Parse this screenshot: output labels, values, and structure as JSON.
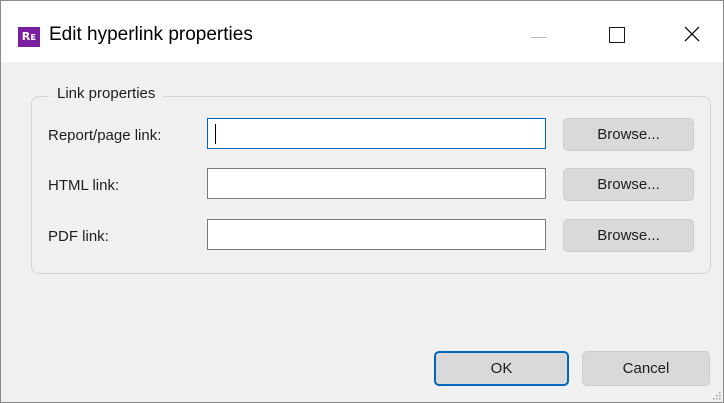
{
  "window": {
    "title": "Edit hyperlink properties",
    "app_icon_text": "Rᴇ",
    "accent_color": "#0067c0",
    "app_icon_color": "#7a1fa2"
  },
  "titlebar_buttons": {
    "minimize_icon": "minimize-icon",
    "maximize_icon": "maximize-icon",
    "close_icon": "close-icon"
  },
  "link_properties": {
    "group_label": "Link properties",
    "report_label": "Report/page link:",
    "report_value": "",
    "html_label": "HTML link:",
    "html_value": "",
    "pdf_label": "PDF link:",
    "pdf_value": "",
    "browse_label": "Browse..."
  },
  "footer": {
    "ok_label": "OK",
    "cancel_label": "Cancel"
  }
}
